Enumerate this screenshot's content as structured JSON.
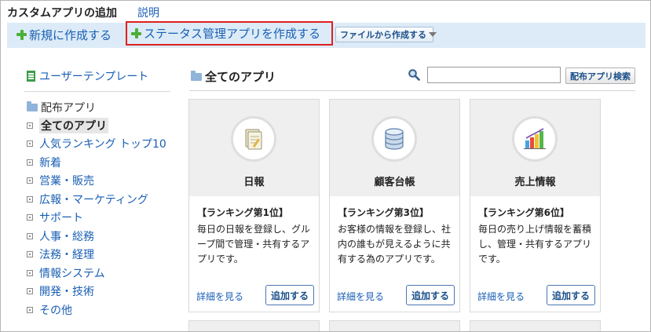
{
  "header": {
    "title": "カスタムアプリの追加",
    "help_link": "説明"
  },
  "toolbar": {
    "new_app": "新規に作成する",
    "status_app": "ステータス管理アプリを作成する",
    "from_file": "ファイルから作成する"
  },
  "sidebar": {
    "user_template": "ユーザーテンプレート",
    "distributed_root": "配布アプリ",
    "categories": [
      "全てのアプリ",
      "人気ランキング トップ10",
      "新着",
      "営業・販売",
      "広報・マーケティング",
      "サポート",
      "人事・総務",
      "法務・経理",
      "情報システム",
      "開発・技術",
      "その他"
    ],
    "selected_index": 0
  },
  "main": {
    "title": "全てのアプリ",
    "search": {
      "value": "",
      "button": "配布アプリ検索"
    },
    "cards": [
      {
        "name": "日報",
        "icon": "notepad-icon",
        "rank": "【ランキング第1位】",
        "desc": "毎日の日報を登録し、グループ間で管理・共有するアプリです。",
        "detail": "詳細を見る",
        "add": "追加する"
      },
      {
        "name": "顧客台帳",
        "icon": "database-icon",
        "rank": "【ランキング第3位】",
        "desc": "お客様の情報を登録し、社内の誰もが見えるように共有する為のアプリです。",
        "detail": "詳細を見る",
        "add": "追加する"
      },
      {
        "name": "売上情報",
        "icon": "bar-chart-icon",
        "rank": "【ランキング第6位】",
        "desc": "毎日の売り上げ情報を蓄積し、管理・共有するアプリです。",
        "detail": "詳細を見る",
        "add": "追加する"
      }
    ]
  },
  "colors": {
    "toolbar_bg": "#dcebf7",
    "link": "#1a5fb4",
    "highlight_border": "#e02020"
  }
}
